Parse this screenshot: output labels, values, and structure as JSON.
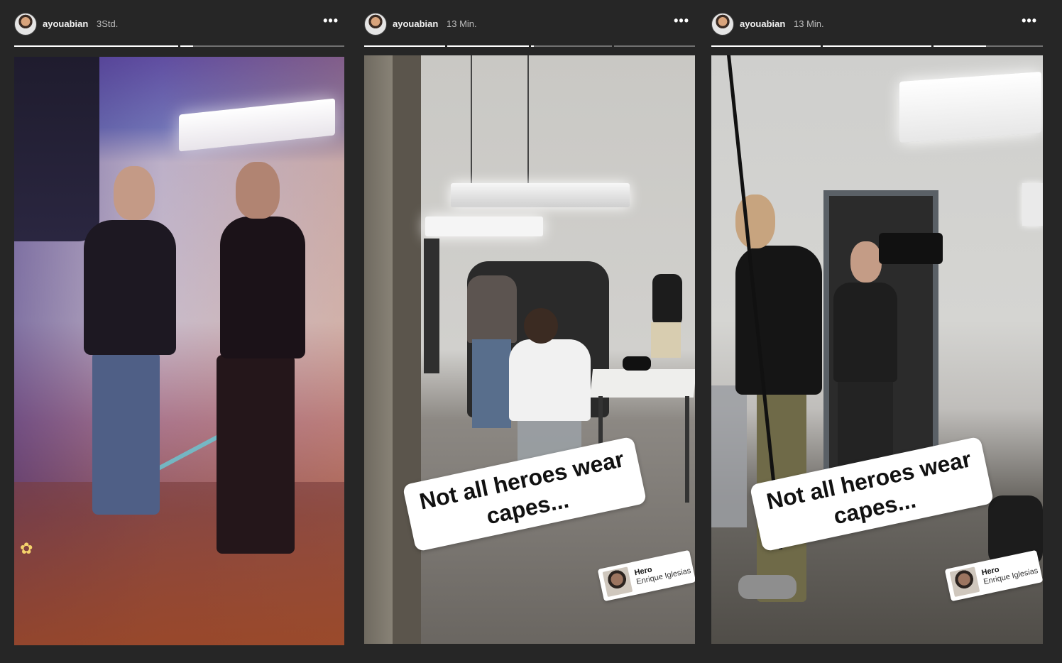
{
  "stories": [
    {
      "username": "ayouabian",
      "time": "3Std.",
      "more_label": "•••",
      "progress": [
        1.0,
        0.08
      ],
      "sticker": null,
      "music": null
    },
    {
      "username": "ayouabian",
      "time": "13 Min.",
      "more_label": "•••",
      "progress": [
        1.0,
        1.0,
        0.04,
        0.0
      ],
      "sticker": {
        "line1": "Not all heroes wear",
        "line2": "capes..."
      },
      "music": {
        "song": "Hero",
        "artist": "Enrique Iglesias"
      }
    },
    {
      "username": "ayouabian",
      "time": "13 Min.",
      "more_label": "•••",
      "progress": [
        1.0,
        1.0,
        0.48
      ],
      "sticker": {
        "line1": "Not all heroes wear",
        "line2": "capes..."
      },
      "music": {
        "song": "Hero",
        "artist": "Enrique Iglesias"
      }
    }
  ],
  "icons": {
    "avatar": "profile-avatar",
    "more": "more-horizontal-icon",
    "flower": "flower-icon"
  },
  "colors": {
    "background": "#262626",
    "progress_fill": "#ffffff",
    "progress_track": "rgba(255,255,255,0.35)"
  }
}
